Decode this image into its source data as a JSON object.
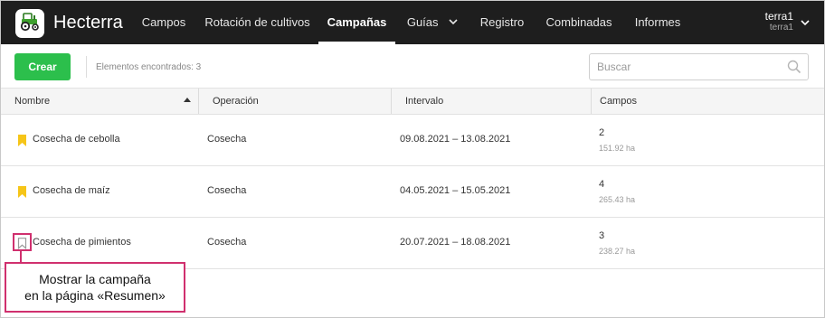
{
  "app": {
    "brand": "Hecterra",
    "logo_icon": "tractor-icon"
  },
  "nav": {
    "items": [
      {
        "label": "Campos"
      },
      {
        "label": "Rotación de cultivos"
      },
      {
        "label": "Campañas",
        "active": true
      },
      {
        "label": "Guías",
        "dropdown": true
      },
      {
        "label": "Registro"
      },
      {
        "label": "Combinadas"
      },
      {
        "label": "Informes"
      }
    ],
    "user": {
      "name": "terra1",
      "sub": "terra1"
    }
  },
  "toolbar": {
    "create_label": "Crear",
    "found_text": "Elementos encontrados: 3",
    "search_placeholder": "Buscar",
    "search_value": ""
  },
  "table": {
    "headers": [
      "Nombre",
      "Operación",
      "Intervalo",
      "Campos"
    ],
    "sort_column": "Nombre",
    "sort_direction": "ascending",
    "rows": [
      {
        "name": "Cosecha de cebolla",
        "operation": "Cosecha",
        "interval": "09.08.2021 – 13.08.2021",
        "fields_count": "2",
        "fields_area": "151.92 ha",
        "bookmarked": true
      },
      {
        "name": "Cosecha de maíz",
        "operation": "Cosecha",
        "interval": "04.05.2021 – 15.05.2021",
        "fields_count": "4",
        "fields_area": "265.43 ha",
        "bookmarked": true
      },
      {
        "name": "Cosecha de pimientos",
        "operation": "Cosecha",
        "interval": "20.07.2021 – 18.08.2021",
        "fields_count": "3",
        "fields_area": "238.27 ha",
        "bookmarked": false
      }
    ]
  },
  "callout": {
    "line1": "Mostrar la campaña",
    "line2": "en la página «Resumen»"
  },
  "colors": {
    "topbar": "#1e1e1e",
    "accent_green": "#2cbf4c",
    "bookmark_yellow": "#f6c518",
    "callout_border": "#d0306e"
  }
}
